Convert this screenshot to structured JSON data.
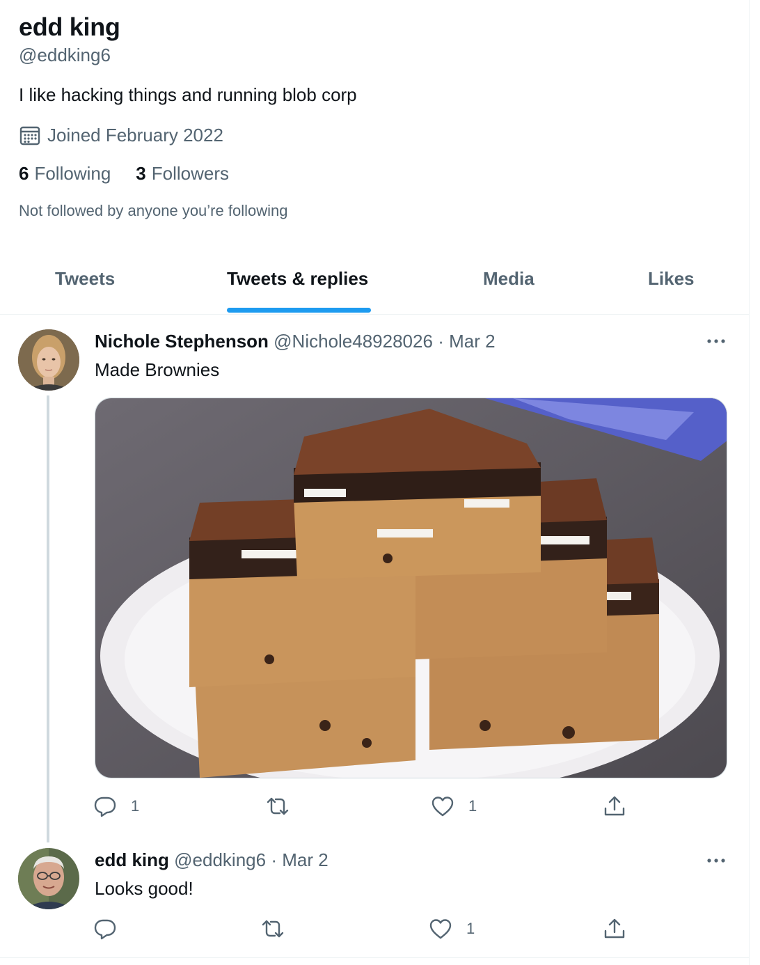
{
  "profile": {
    "name": "edd king",
    "handle": "@eddking6",
    "bio": "I like hacking things and running blob corp",
    "joined": "Joined February 2022",
    "following_count": "6",
    "following_label": "Following",
    "followers_count": "3",
    "followers_label": "Followers",
    "not_followed": "Not followed by anyone you’re following"
  },
  "tabs": [
    {
      "label": "Tweets",
      "active": false
    },
    {
      "label": "Tweets & replies",
      "active": true
    },
    {
      "label": "Media",
      "active": false
    },
    {
      "label": "Likes",
      "active": false
    }
  ],
  "tweets": [
    {
      "author": "Nichole Stephenson",
      "handle": "@Nichole48928026",
      "separator": "·",
      "date": "Mar 2",
      "text": "Made Brownies",
      "reply_count": "1",
      "retweet_count": "",
      "like_count": "1"
    },
    {
      "author": "edd king",
      "handle": "@eddking6",
      "separator": "·",
      "date": "Mar 2",
      "text": "Looks good!",
      "reply_count": "",
      "retweet_count": "",
      "like_count": "1"
    }
  ],
  "colors": {
    "accent": "#1d9bf0",
    "text_primary": "#0f1419",
    "text_secondary": "#536471",
    "border": "#eff3f4"
  },
  "icons": {
    "calendar": "calendar-icon",
    "reply": "reply-icon",
    "retweet": "retweet-icon",
    "like": "heart-icon",
    "share": "share-icon",
    "more": "more-icon"
  }
}
